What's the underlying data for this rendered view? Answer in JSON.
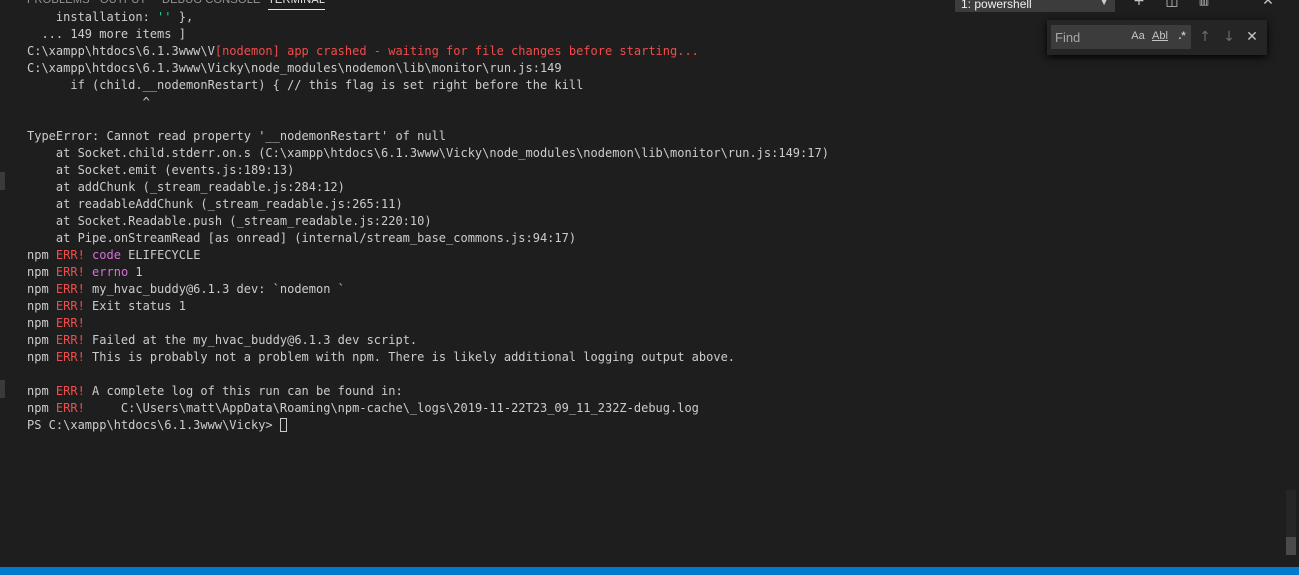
{
  "panel": {
    "tabs": [
      {
        "label": "PROBLEMS",
        "active": false
      },
      {
        "label": "OUTPUT",
        "active": false
      },
      {
        "label": "DEBUG CONSOLE",
        "active": false
      },
      {
        "label": "TERMINAL",
        "active": true
      }
    ],
    "terminal_selector": "1: powershell",
    "actions": [
      {
        "icon": "plus-icon",
        "glyph": "+"
      },
      {
        "icon": "split-terminal-icon",
        "glyph": "◫"
      },
      {
        "icon": "trash-icon",
        "glyph": "🗑"
      },
      {
        "icon": "chevron-up-icon",
        "glyph": "⌃"
      },
      {
        "icon": "close-icon",
        "glyph": "✕"
      }
    ]
  },
  "find_widget": {
    "placeholder": "Find",
    "match_case": "Aa",
    "whole_word": "Abl",
    "regex": ".*",
    "prev": "↑",
    "next": "↓",
    "close": "✕"
  },
  "terminal": {
    "lines": [
      [
        {
          "t": "    installation: "
        },
        {
          "t": "''",
          "c": "grn"
        },
        {
          "t": " },"
        }
      ],
      [
        {
          "t": "  ... 149 more items ]"
        }
      ],
      [
        {
          "t": "C:\\xampp\\htdocs\\6.1.3www\\V"
        },
        {
          "t": "[nodemon] app crashed - waiting for file changes before starting...",
          "c": "red"
        }
      ],
      [
        {
          "t": "C:\\xampp\\htdocs\\6.1.3www\\Vicky\\node_modules\\nodemon\\lib\\monitor\\run.js:149"
        }
      ],
      [
        {
          "t": "      if (child.__nodemonRestart) { // this flag is set right before the kill"
        }
      ],
      [
        {
          "t": "                ^"
        }
      ],
      [
        {
          "t": ""
        }
      ],
      [
        {
          "t": "TypeError: Cannot read property '__nodemonRestart' of null"
        }
      ],
      [
        {
          "t": "    at Socket.child.stderr.on.s (C:\\xampp\\htdocs\\6.1.3www\\Vicky\\node_modules\\nodemon\\lib\\monitor\\run.js:149:17)"
        }
      ],
      [
        {
          "t": "    at Socket.emit (events.js:189:13)"
        }
      ],
      [
        {
          "t": "    at addChunk (_stream_readable.js:284:12)"
        }
      ],
      [
        {
          "t": "    at readableAddChunk (_stream_readable.js:265:11)"
        }
      ],
      [
        {
          "t": "    at Socket.Readable.push (_stream_readable.js:220:10)"
        }
      ],
      [
        {
          "t": "    at Pipe.onStreamRead [as onread] (internal/stream_base_commons.js:94:17)"
        }
      ],
      [
        {
          "t": "npm "
        },
        {
          "t": "ERR!",
          "c": "red"
        },
        {
          "t": " "
        },
        {
          "t": "code",
          "c": "mag"
        },
        {
          "t": " ELIFECYCLE"
        }
      ],
      [
        {
          "t": "npm "
        },
        {
          "t": "ERR!",
          "c": "red"
        },
        {
          "t": " "
        },
        {
          "t": "errno",
          "c": "mag"
        },
        {
          "t": " 1"
        }
      ],
      [
        {
          "t": "npm "
        },
        {
          "t": "ERR!",
          "c": "red"
        },
        {
          "t": " my_hvac_buddy@6.1.3 dev: `nodemon `"
        }
      ],
      [
        {
          "t": "npm "
        },
        {
          "t": "ERR!",
          "c": "red"
        },
        {
          "t": " Exit status 1"
        }
      ],
      [
        {
          "t": "npm "
        },
        {
          "t": "ERR!",
          "c": "red"
        }
      ],
      [
        {
          "t": "npm "
        },
        {
          "t": "ERR!",
          "c": "red"
        },
        {
          "t": " Failed at the my_hvac_buddy@6.1.3 dev script."
        }
      ],
      [
        {
          "t": "npm "
        },
        {
          "t": "ERR!",
          "c": "red"
        },
        {
          "t": " This is probably not a problem with npm. There is likely additional logging output above."
        }
      ],
      [
        {
          "t": ""
        }
      ],
      [
        {
          "t": "npm "
        },
        {
          "t": "ERR!",
          "c": "red"
        },
        {
          "t": " A complete log of this run can be found in:"
        }
      ],
      [
        {
          "t": "npm "
        },
        {
          "t": "ERR!",
          "c": "red"
        },
        {
          "t": "     C:\\Users\\matt\\AppData\\Roaming\\npm-cache\\_logs\\2019-11-22T23_09_11_232Z-debug.log"
        }
      ]
    ],
    "prompt": "PS C:\\xampp\\htdocs\\6.1.3www\\Vicky> "
  },
  "colors": {
    "background": "#1e1e1e",
    "error_red": "#f14c4c",
    "magenta": "#d670d6",
    "green": "#23d18b",
    "status_bar": "#007acc"
  }
}
